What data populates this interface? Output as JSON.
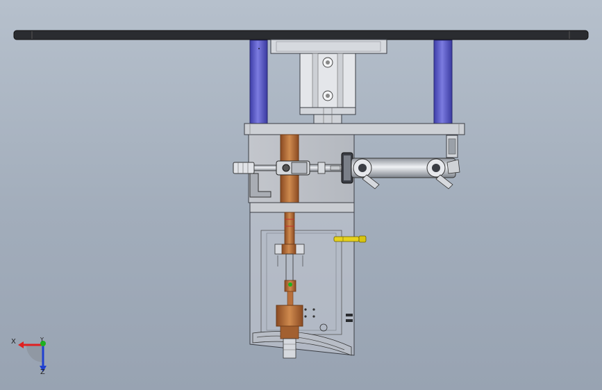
{
  "viewport": {
    "background_top": "#b6c0cc",
    "background_bottom": "#98a3b2"
  },
  "triad": {
    "x_label": "X",
    "y_label": "Y",
    "z_label": "Z",
    "x_color": "#e02020",
    "y_color": "#20b020",
    "z_color": "#2040d0"
  },
  "colors": {
    "steel": "#c9ccd2",
    "dark_plate": "#2a2c30",
    "blue_rod": "#5a5ac8",
    "copper": "#b8703c",
    "yellow_pin": "#e6d21e",
    "outline": "#3a3d44"
  }
}
